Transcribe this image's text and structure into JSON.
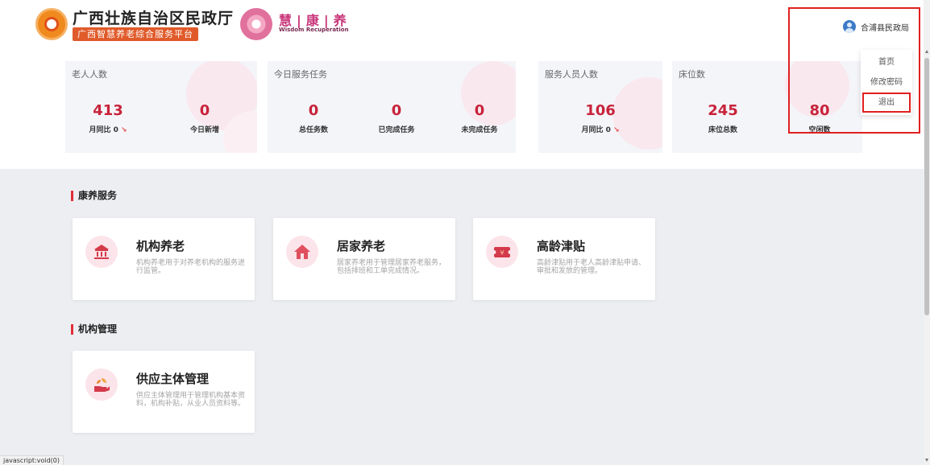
{
  "header": {
    "org_title": "广西壮族自治区民政厅",
    "org_subtitle": "广西智慧养老综合服务平台",
    "brand_cn": "慧|康|养",
    "brand_en": "Wisdom Recuperation",
    "user_name": "合浦县民政局"
  },
  "user_menu": {
    "items": [
      "首页",
      "修改密码",
      "退出"
    ],
    "active_index": 2
  },
  "stats": {
    "elderly": {
      "title": "老人人数",
      "total": "413",
      "total_label": "月同比 0",
      "new_today": "0",
      "new_today_label": "今日新增"
    },
    "tasks": {
      "title": "今日服务任务",
      "total": "0",
      "total_label": "总任务数",
      "completed": "0",
      "completed_label": "已完成任务",
      "pending": "0",
      "pending_label": "未完成任务"
    },
    "staff": {
      "title": "服务人员人数",
      "total": "106",
      "total_label": "月同比 0"
    },
    "beds": {
      "title": "床位数",
      "total": "245",
      "total_label": "床位总数",
      "vacant": "80",
      "vacant_label": "空闲数"
    },
    "trend_icon": "down-trend-icon"
  },
  "sections": [
    {
      "title": "康养服务",
      "cards": [
        {
          "icon": "institution-icon",
          "title": "机构养老",
          "desc": "机构养老用于对养老机构的服务进行监管。"
        },
        {
          "icon": "home-icon",
          "title": "居家养老",
          "desc": "居家养老用于管理居家养老服务，包括排班和工单完成情况。"
        },
        {
          "icon": "ticket-icon",
          "title": "高龄津贴",
          "desc": "高龄津贴用于老人高龄津贴申请、审批和发放的管理。"
        }
      ]
    },
    {
      "title": "机构管理",
      "cards": [
        {
          "icon": "hand-plant-icon",
          "title": "供应主体管理",
          "desc": "供应主体管理用于管理机构基本资料，机构补贴，从业人员资料等。"
        }
      ]
    }
  ],
  "statusbar": "javascript:void(0)",
  "colors": {
    "accent_red": "#c8233a",
    "highlight_red": "#e02020",
    "icon_bg": "#fbe4ea",
    "brand_pink": "#c8357a",
    "page_bg": "#eceef2"
  }
}
